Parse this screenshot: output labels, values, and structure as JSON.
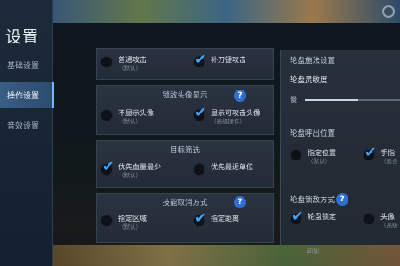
{
  "sidebar": {
    "title": "设置",
    "items": [
      {
        "label": "基础设置"
      },
      {
        "label": "操作设置"
      },
      {
        "label": "音效设置"
      }
    ]
  },
  "sections": {
    "attack": {
      "opt1_label": "普通攻击",
      "opt1_sub": "（默认）",
      "opt2_label": "补刀键攻击"
    },
    "lock_avatar": {
      "title": "锁敌头像显示",
      "opt1_label": "不显示头像",
      "opt1_sub": "（默认）",
      "opt2_label": "显示可攻击头像",
      "opt2_sub": "（高级操作）"
    },
    "target_filter": {
      "title": "目标筛选",
      "opt1_label": "优先血量最少",
      "opt1_sub": "（默认）",
      "opt2_label": "优先最近单位"
    },
    "skill_cancel": {
      "title": "技能取消方式",
      "opt1_label": "指定区域",
      "opt1_sub": "（默认）",
      "opt2_label": "指定距离"
    }
  },
  "right": {
    "wheel_filter_title": "轮盘施法设置",
    "sensitivity_label": "轮盘灵敏度",
    "slow_label": "慢",
    "wheel_position_title": "轮盘呼出位置",
    "pos_opt1_label": "指定位置",
    "pos_opt1_sub": "（默认）",
    "pos_opt2_label": "手指",
    "pos_opt2_sub": "（适合",
    "lock_mode_title": "轮盘锁敌方式",
    "lock_opt1_label": "轮盘锁定",
    "lock_opt2_label": "头像",
    "lock_opt2_sub": "（高级"
  },
  "bottom": {
    "text": "回到"
  },
  "help_glyph": "?",
  "colors": {
    "accent": "#3da7ff",
    "help": "#2e6fd1",
    "active_tab": "#3a5e86"
  }
}
